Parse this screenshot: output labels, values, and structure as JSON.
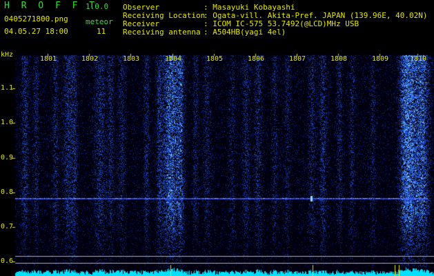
{
  "header": {
    "logo": "H R O F F T",
    "version": "1.0.0",
    "filename": "0405271800.png",
    "datetime": "04.05.27 18:00",
    "meteor_label": "meteor",
    "meteor_count": "11",
    "info": [
      {
        "label": "Observer",
        "value": ": Masayuki Kobayashi"
      },
      {
        "label": "Receiving Location",
        "value": ": Ogata-vill. Akita-Pref. JAPAN (139.96E, 40.02N)"
      },
      {
        "label": "Receiver",
        "value": ": ICOM IC-575 53.7492(@LCD)MHz USB"
      },
      {
        "label": "Receiving antenna",
        "value": ": A504HB(yagi 4el)"
      }
    ]
  },
  "spectrogram": {
    "y_unit": "kHz",
    "time_ticks": [
      "1801",
      "1802",
      "1803",
      "1804",
      "1805",
      "1806",
      "1807",
      "1808",
      "1809",
      "1810"
    ],
    "freq_ticks": [
      "1.1",
      "1.0",
      "0.9",
      "0.8",
      "0.7",
      "0.6"
    ],
    "colors": {
      "background": "#000010",
      "noise": "#1e3cc8",
      "hot": "#9ad8ff",
      "trace": "#4060ff",
      "histogram": "#00e0ff",
      "ticks": "#e8e800"
    }
  }
}
